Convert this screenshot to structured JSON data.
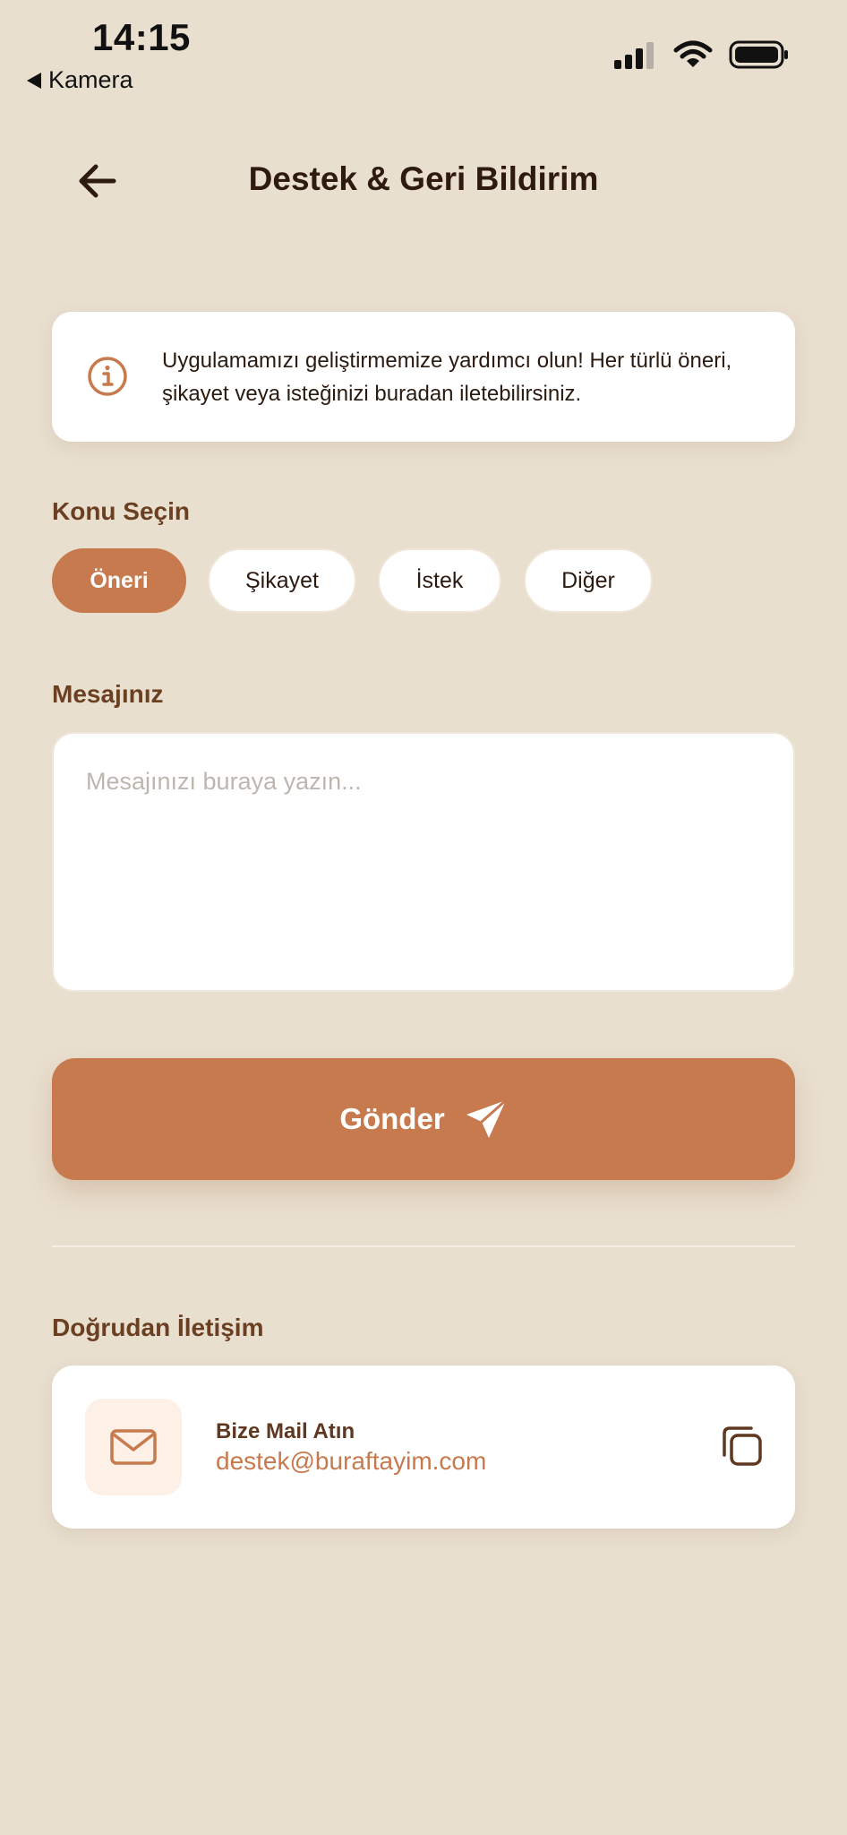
{
  "status_bar": {
    "time": "14:15",
    "back_app": "Kamera"
  },
  "header": {
    "title": "Destek & Geri Bildirim"
  },
  "info": {
    "text": "Uygulamamızı geliştirmemize yardımcı olun! Her türlü öneri, şikayet veya isteğinizi buradan iletebilirsiniz."
  },
  "topic": {
    "label": "Konu Seçin",
    "chips": [
      {
        "label": "Öneri",
        "active": true
      },
      {
        "label": "Şikayet",
        "active": false
      },
      {
        "label": "İstek",
        "active": false
      },
      {
        "label": "Diğer",
        "active": false
      }
    ]
  },
  "message": {
    "label": "Mesajınız",
    "placeholder": "Mesajınızı buraya yazın...",
    "value": ""
  },
  "send": {
    "label": "Gönder"
  },
  "contact": {
    "section_label": "Doğrudan İletişim",
    "title": "Bize Mail Atın",
    "email": "destek@buraftayim.com"
  },
  "icons": {
    "back": "arrow-left-icon",
    "info": "info-circle-icon",
    "send": "paper-plane-icon",
    "mail": "envelope-icon",
    "copy": "copy-icon",
    "signal": "cellular-signal-icon",
    "wifi": "wifi-icon",
    "battery": "battery-icon"
  },
  "colors": {
    "background": "#E9DFCF",
    "accent": "#C77A4E",
    "label_brown": "#6B3F22",
    "title_dark": "#2E1A0F",
    "mail_icon_bg": "#FDF1E7"
  }
}
